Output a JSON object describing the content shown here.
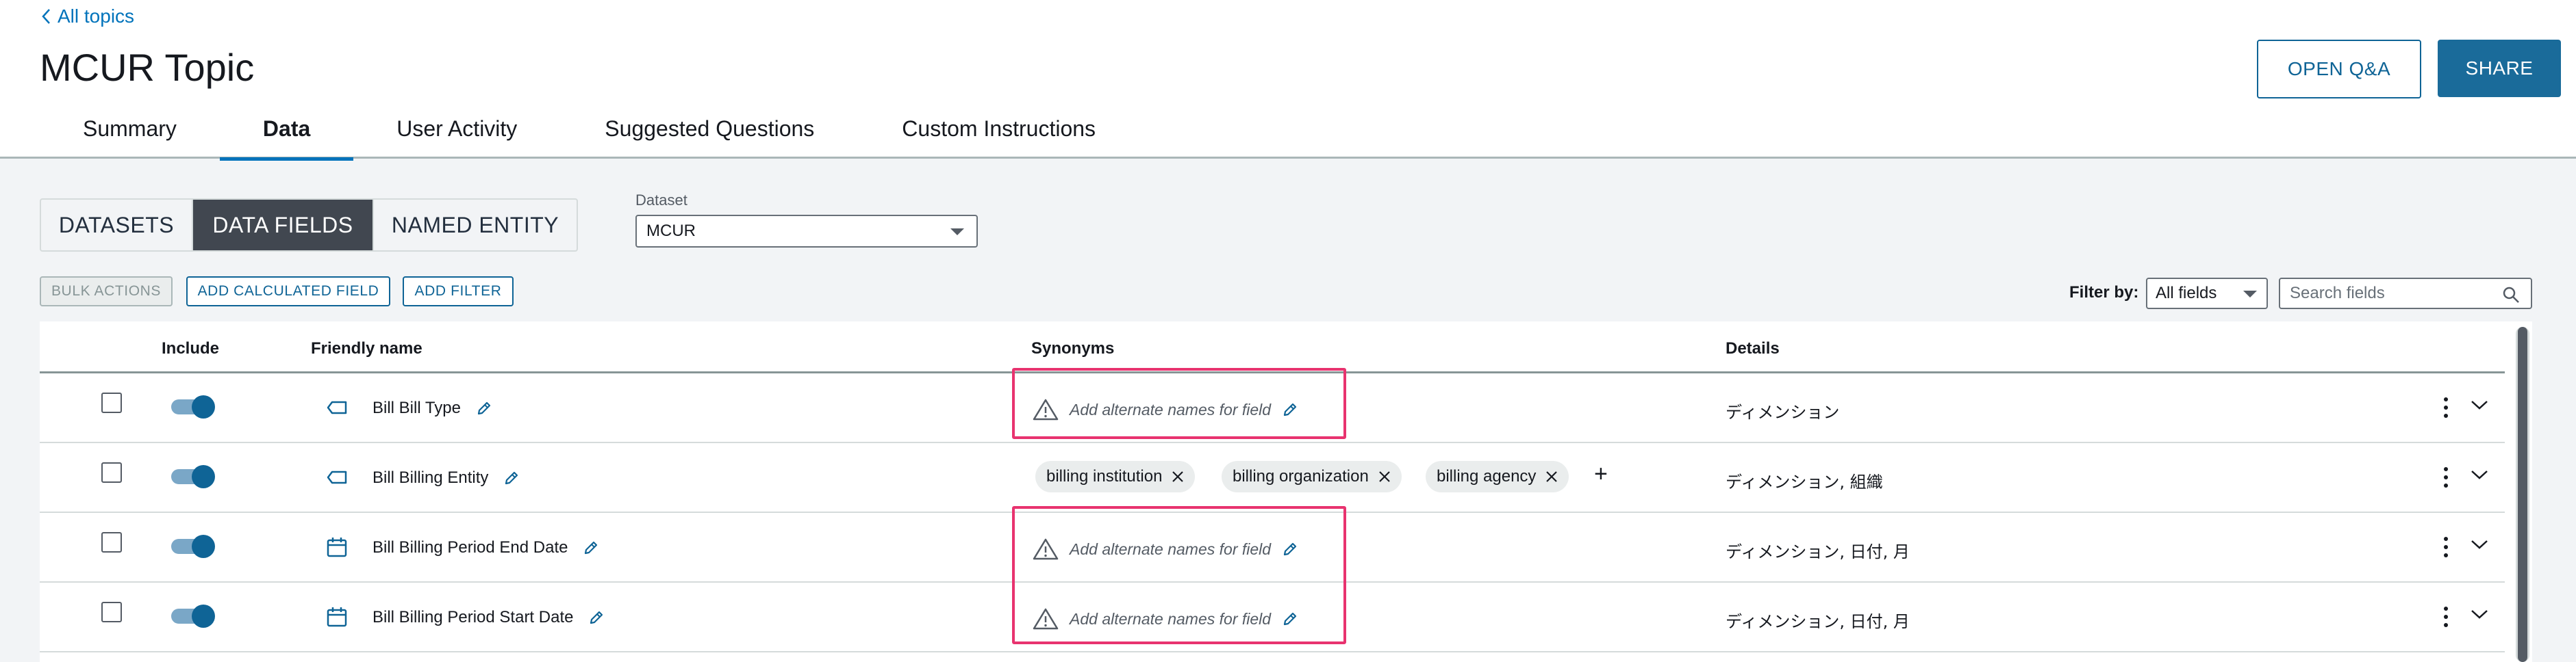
{
  "header": {
    "back_label": "All topics",
    "title": "MCUR Topic",
    "open_qa_label": "OPEN Q&A",
    "share_label": "SHARE"
  },
  "tabs": [
    {
      "label": "Summary",
      "active": false
    },
    {
      "label": "Data",
      "active": true
    },
    {
      "label": "User Activity",
      "active": false
    },
    {
      "label": "Suggested Questions",
      "active": false
    },
    {
      "label": "Custom Instructions",
      "active": false
    }
  ],
  "segment": {
    "items": [
      "DATASETS",
      "DATA FIELDS",
      "NAMED ENTITY"
    ],
    "active": "DATA FIELDS"
  },
  "dataset": {
    "label": "Dataset",
    "value": "MCUR"
  },
  "toolbar": {
    "bulk_actions": "BULK ACTIONS",
    "add_calculated_field": "ADD CALCULATED FIELD",
    "add_filter": "ADD FILTER",
    "filter_by_label": "Filter by:",
    "filter_value": "All fields",
    "search_placeholder": "Search fields"
  },
  "table": {
    "columns": {
      "include": "Include",
      "friendly_name": "Friendly name",
      "synonyms": "Synonyms",
      "details": "Details"
    },
    "rows": [
      {
        "field_icon": "dimension-tag-icon",
        "name": "Bill Bill Type",
        "synonyms": [],
        "synonym_placeholder": "Add alternate names for field",
        "details": "ディメンション",
        "included": true,
        "highlighted": true
      },
      {
        "field_icon": "dimension-tag-icon",
        "name": "Bill Billing Entity",
        "synonyms": [
          "billing institution",
          "billing organization",
          "billing agency"
        ],
        "details": "ディメンション, 組織",
        "included": true,
        "highlighted": false
      },
      {
        "field_icon": "calendar-icon",
        "name": "Bill Billing Period End Date",
        "synonyms": [],
        "synonym_placeholder": "Add alternate names for field",
        "details": "ディメンション, 日付, 月",
        "included": true,
        "highlighted": true
      },
      {
        "field_icon": "calendar-icon",
        "name": "Bill Billing Period Start Date",
        "synonyms": [],
        "synonym_placeholder": "Add alternate names for field",
        "details": "ディメンション, 日付, 月",
        "included": true,
        "highlighted": true
      }
    ]
  },
  "colors": {
    "accent": "#0073bb",
    "primary_button": "#1a6b9a",
    "highlight": "#e8336f",
    "segment_active": "#414750"
  }
}
